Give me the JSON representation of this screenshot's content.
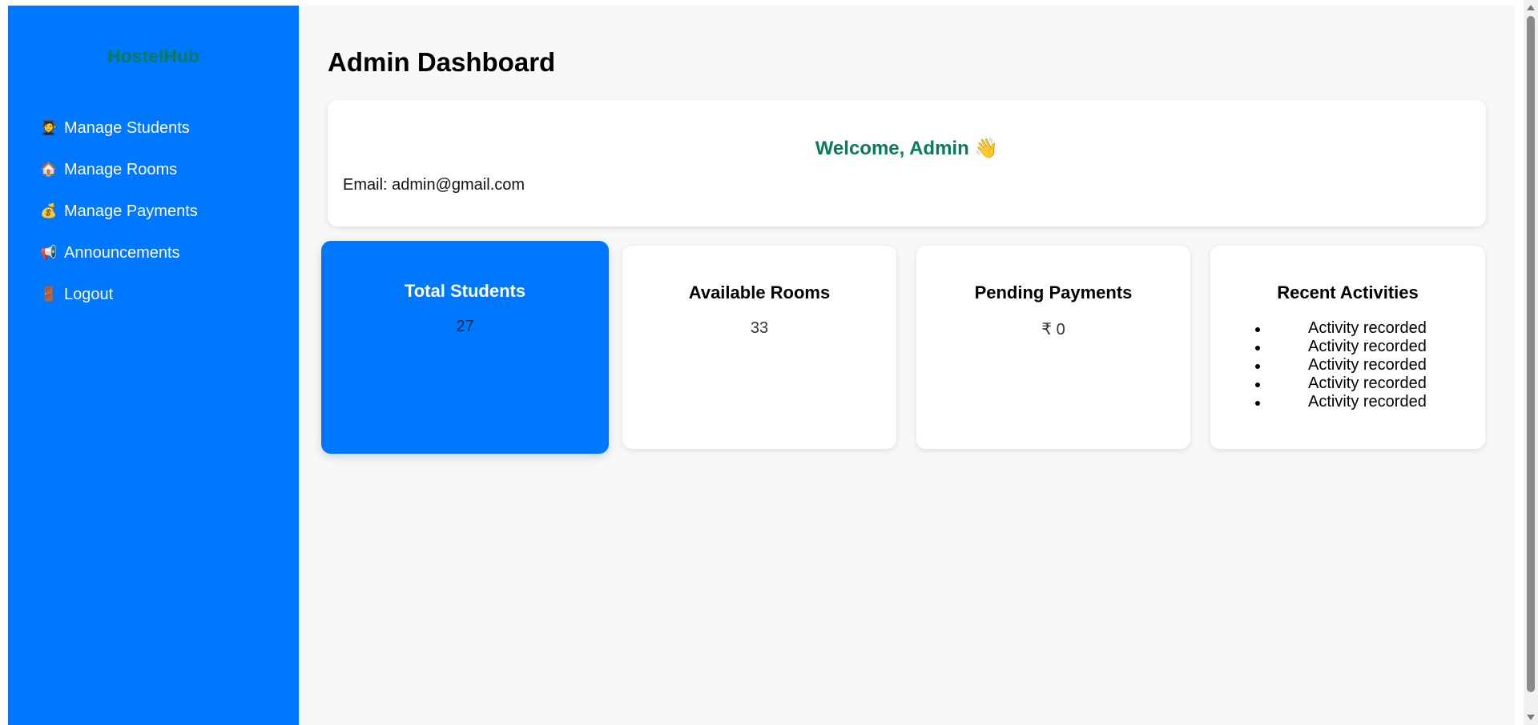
{
  "sidebar": {
    "brand": "HostelHub",
    "items": [
      {
        "icon": "🧑‍🎓",
        "icon_name": "student-icon",
        "label": "Manage Students"
      },
      {
        "icon": "🏠",
        "icon_name": "house-icon",
        "label": "Manage Rooms"
      },
      {
        "icon": "💰",
        "icon_name": "money-bag-icon",
        "label": "Manage Payments"
      },
      {
        "icon": "📢",
        "icon_name": "megaphone-icon",
        "label": "Announcements"
      },
      {
        "icon": "🚪",
        "icon_name": "door-icon",
        "label": "Logout"
      }
    ]
  },
  "main": {
    "title": "Admin Dashboard",
    "welcome": {
      "heading": "Welcome, Admin 👋",
      "email": "Email: admin@gmail.com"
    },
    "cards": [
      {
        "title": "Total Students",
        "value": "27"
      },
      {
        "title": "Available Rooms",
        "value": "33"
      },
      {
        "title": "Pending Payments",
        "value": "₹ 0"
      },
      {
        "title": "Recent Activities",
        "items": [
          "Activity recorded",
          "Activity recorded",
          "Activity recorded",
          "Activity recorded",
          "Activity recorded"
        ]
      }
    ]
  },
  "colors": {
    "sidebar_bg": "#0077ff",
    "brand_text": "#0a7a5e",
    "page_bg": "#f7f8fa"
  }
}
